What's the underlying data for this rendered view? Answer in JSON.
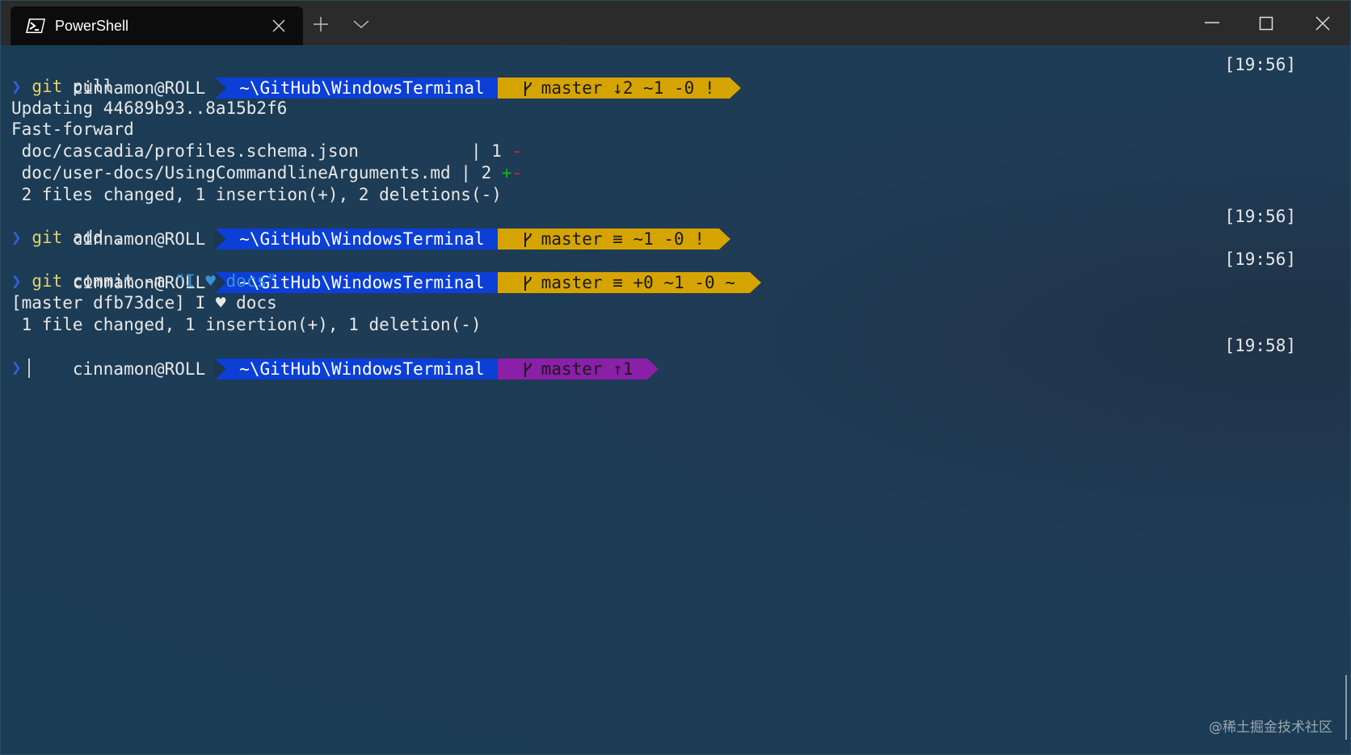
{
  "window": {
    "tab_title": "PowerShell",
    "tab_icon": "powershell-icon",
    "controls": [
      "new-tab-icon",
      "chevron-down-icon",
      "minimize-icon",
      "maximize-icon",
      "close-icon"
    ]
  },
  "terminal": {
    "prompts": [
      {
        "user": "cinnamon@ROLL",
        "path": "~\\GitHub\\WindowsTerminal",
        "git": "master ↓2 ~1 -0 !",
        "git_color": "#d6a400",
        "time": "[19:56]",
        "command": "git",
        "args": " pull"
      },
      {
        "user": "cinnamon@ROLL",
        "path": "~\\GitHub\\WindowsTerminal",
        "git": "master ≡ ~1 -0 !",
        "git_color": "#d6a400",
        "time": "[19:56]",
        "command": "git",
        "args": " add ."
      },
      {
        "user": "cinnamon@ROLL",
        "path": "~\\GitHub\\WindowsTerminal",
        "git": "master ≡ +0 ~1 -0 ~",
        "git_color": "#d6a400",
        "time": "[19:56]",
        "command": "git",
        "args": " commit -m ",
        "string": "\"I ♥ docs\""
      },
      {
        "user": "cinnamon@ROLL",
        "path": "~\\GitHub\\WindowsTerminal",
        "git": "master ↑1",
        "git_color": "#8a1fa8",
        "time": "[19:58]"
      }
    ],
    "output_pull": {
      "l1": "Updating 44689b93..8a15b2f6",
      "l2": "Fast-forward",
      "l3_file": " doc/cascadia/profiles.schema.json           | 1 ",
      "l3_diff": "-",
      "l4_file": " doc/user-docs/UsingCommandlineArguments.md | 2 ",
      "l4_plus": "+",
      "l4_minus": "-",
      "l5": " 2 files changed, 1 insertion(+), 2 deletions(-)"
    },
    "output_commit": {
      "l1": "[master dfb73dce] I ♥ docs",
      "l2": " 1 file changed, 1 insertion(+), 1 deletion(-)"
    },
    "prompt_char": "❯"
  },
  "watermark": "@稀土掘金技术社区"
}
